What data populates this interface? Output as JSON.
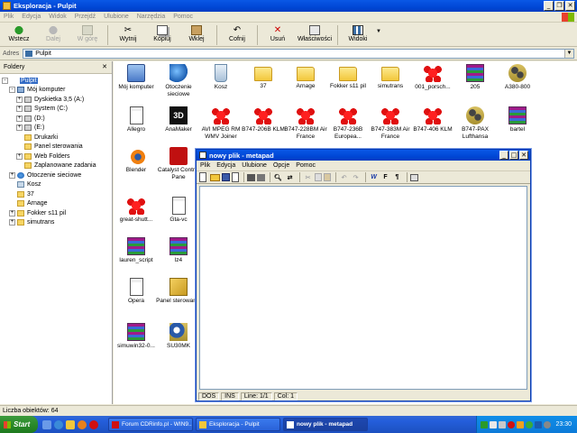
{
  "explorer": {
    "title": "Eksploracja - Pulpit",
    "menu": [
      "Plik",
      "Edycja",
      "Widok",
      "Przejdź",
      "Ulubione",
      "Narzędzia",
      "Pomoc"
    ],
    "toolbar": {
      "back": "Wstecz",
      "forward": "Dalej",
      "up": "W górę",
      "cut": "Wytnij",
      "copy": "Kopiuj",
      "paste": "Wklej",
      "undo": "Cofnij",
      "delete": "Usuń",
      "properties": "Właściwości",
      "views": "Widoki"
    },
    "address_label": "Adres",
    "address_value": "Pulpit",
    "folders_title": "Foldery",
    "tree": [
      {
        "label": "Pulpit",
        "level": 0,
        "icon": "desktop",
        "expander": "-",
        "selected": true
      },
      {
        "label": "Mój komputer",
        "level": 1,
        "icon": "pc",
        "expander": "-"
      },
      {
        "label": "Dyskietka 3,5 (A:)",
        "level": 2,
        "icon": "drive",
        "expander": "+"
      },
      {
        "label": "System (C:)",
        "level": 2,
        "icon": "drive",
        "expander": "+"
      },
      {
        "label": "(D:)",
        "level": 2,
        "icon": "drive",
        "expander": "+"
      },
      {
        "label": "(E:)",
        "level": 2,
        "icon": "drive",
        "expander": "+"
      },
      {
        "label": "Drukarki",
        "level": 2,
        "icon": "folder",
        "expander": ""
      },
      {
        "label": "Panel sterowania",
        "level": 2,
        "icon": "folder",
        "expander": ""
      },
      {
        "label": "Web Folders",
        "level": 2,
        "icon": "folder",
        "expander": "+"
      },
      {
        "label": "Zaplanowane zadania",
        "level": 2,
        "icon": "folder",
        "expander": ""
      },
      {
        "label": "Otoczenie sieciowe",
        "level": 1,
        "icon": "net",
        "expander": "+"
      },
      {
        "label": "Kosz",
        "level": 1,
        "icon": "bin",
        "expander": ""
      },
      {
        "label": "37",
        "level": 1,
        "icon": "folder",
        "expander": ""
      },
      {
        "label": "Arnage",
        "level": 1,
        "icon": "folder",
        "expander": ""
      },
      {
        "label": "Fokker s11 pil",
        "level": 1,
        "icon": "folder",
        "expander": "+"
      },
      {
        "label": "simutrans",
        "level": 1,
        "icon": "folder",
        "expander": "+"
      }
    ],
    "icons": [
      {
        "label": "Mój komputer",
        "icon": "pc",
        "col": 0,
        "row": 0
      },
      {
        "label": "Otoczenie sieciowe",
        "icon": "net",
        "col": 1,
        "row": 0
      },
      {
        "label": "Kosz",
        "icon": "bin",
        "col": 2,
        "row": 0
      },
      {
        "label": "37",
        "icon": "folder",
        "col": 3,
        "row": 0
      },
      {
        "label": "Arnage",
        "icon": "folder",
        "col": 4,
        "row": 0
      },
      {
        "label": "Fokker s11 pil",
        "icon": "folder",
        "col": 5,
        "row": 0
      },
      {
        "label": "simutrans",
        "icon": "folder",
        "col": 6,
        "row": 0
      },
      {
        "label": "001_porsch...",
        "icon": "star",
        "col": 7,
        "row": 0
      },
      {
        "label": "205",
        "icon": "rar",
        "col": 8,
        "row": 0
      },
      {
        "label": "A380-800",
        "icon": "film",
        "col": 9,
        "row": 0
      },
      {
        "label": "Allegro",
        "icon": "doc",
        "col": 0,
        "row": 1
      },
      {
        "label": "AnaMaker",
        "icon": "threed",
        "col": 1,
        "row": 1
      },
      {
        "label": "AVI MPEG RM WMV Joiner",
        "icon": "star",
        "col": 2,
        "row": 1
      },
      {
        "label": "B747-206B KLM",
        "icon": "star",
        "col": 3,
        "row": 1
      },
      {
        "label": "B747-228BM Air France",
        "icon": "star",
        "col": 4,
        "row": 1
      },
      {
        "label": "B747-236B Europea...",
        "icon": "star",
        "col": 5,
        "row": 1
      },
      {
        "label": "B747-383M Air France",
        "icon": "star",
        "col": 6,
        "row": 1
      },
      {
        "label": "B747-406 KLM",
        "icon": "star",
        "col": 7,
        "row": 1
      },
      {
        "label": "B747-PAX Lufthansa",
        "icon": "film",
        "col": 8,
        "row": 1
      },
      {
        "label": "bartel",
        "icon": "rar",
        "col": 9,
        "row": 1
      },
      {
        "label": "Blender",
        "icon": "blender",
        "col": 0,
        "row": 2
      },
      {
        "label": "Catalyst Control Pane",
        "icon": "catalyst",
        "col": 1,
        "row": 2
      },
      {
        "label": "great-shutt...",
        "icon": "star",
        "col": 0,
        "row": 3
      },
      {
        "label": "Gta-vc",
        "icon": "doc",
        "col": 1,
        "row": 3
      },
      {
        "label": "lauren_script",
        "icon": "rar",
        "col": 0,
        "row": 4
      },
      {
        "label": "lz4",
        "icon": "rar",
        "col": 1,
        "row": 4
      },
      {
        "label": "Opera",
        "icon": "doc",
        "col": 0,
        "row": 5
      },
      {
        "label": "Panel sterowania",
        "icon": "panel",
        "col": 1,
        "row": 5
      },
      {
        "label": "simuwin32-0...",
        "icon": "rar",
        "col": 0,
        "row": 6
      },
      {
        "label": "SU30MK",
        "icon": "su30",
        "col": 1,
        "row": 6
      }
    ],
    "status": "Liczba obiektów: 64"
  },
  "metapad": {
    "title": "nowy plik - metapad",
    "menu": [
      "Plik",
      "Edycja",
      "Ulubione",
      "Opcje",
      "Pomoc"
    ],
    "status": [
      "DOS",
      "INS",
      "Line: 1/1",
      "Col: 1"
    ]
  },
  "taskbar": {
    "start": "Start",
    "tasks": [
      {
        "label": "Forum CDRinfo.pl - WIN9...",
        "active": false
      },
      {
        "label": "Eksploracja - Pulpit",
        "active": false
      },
      {
        "label": "nowy plik - metapad",
        "active": true
      }
    ],
    "clock": "23:30"
  },
  "colors": {
    "accent": "#0047d6",
    "taskbar": "#245edb",
    "start": "#2a8a2a"
  }
}
